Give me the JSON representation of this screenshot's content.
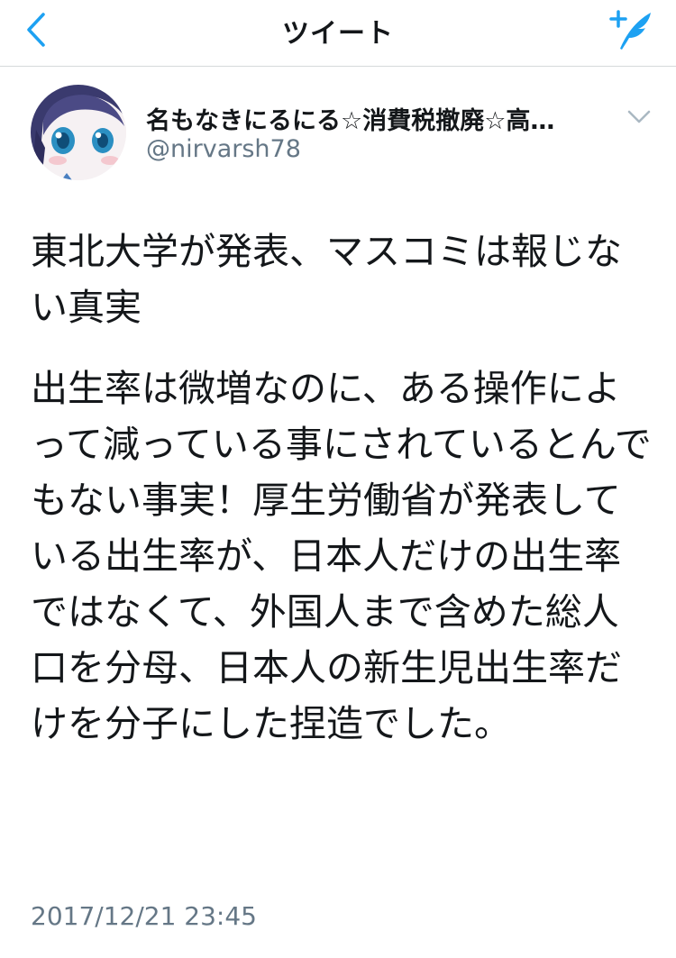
{
  "nav": {
    "title": "ツイート",
    "back_icon": "chevron-left-icon",
    "compose_icon": "compose-tweet-icon",
    "accent_color": "#1da1f2"
  },
  "author": {
    "display_name": "名もなきにるにる☆消費税撤廃☆高…",
    "handle": "@nirvarsh78"
  },
  "tweet": {
    "paragraphs": [
      "東北大学が発表、マスコミは報じない真実",
      "出生率は微増なのに、ある操作によって減っている事にされているとんでもない事実！厚生労働省が発表している出生率が、日本人だけの出生率ではなくて、外国人まで含めた総人口を分母、日本人の新生児出生率だけを分子にした捏造でした。"
    ],
    "timestamp": "2017/12/21 23:45"
  }
}
